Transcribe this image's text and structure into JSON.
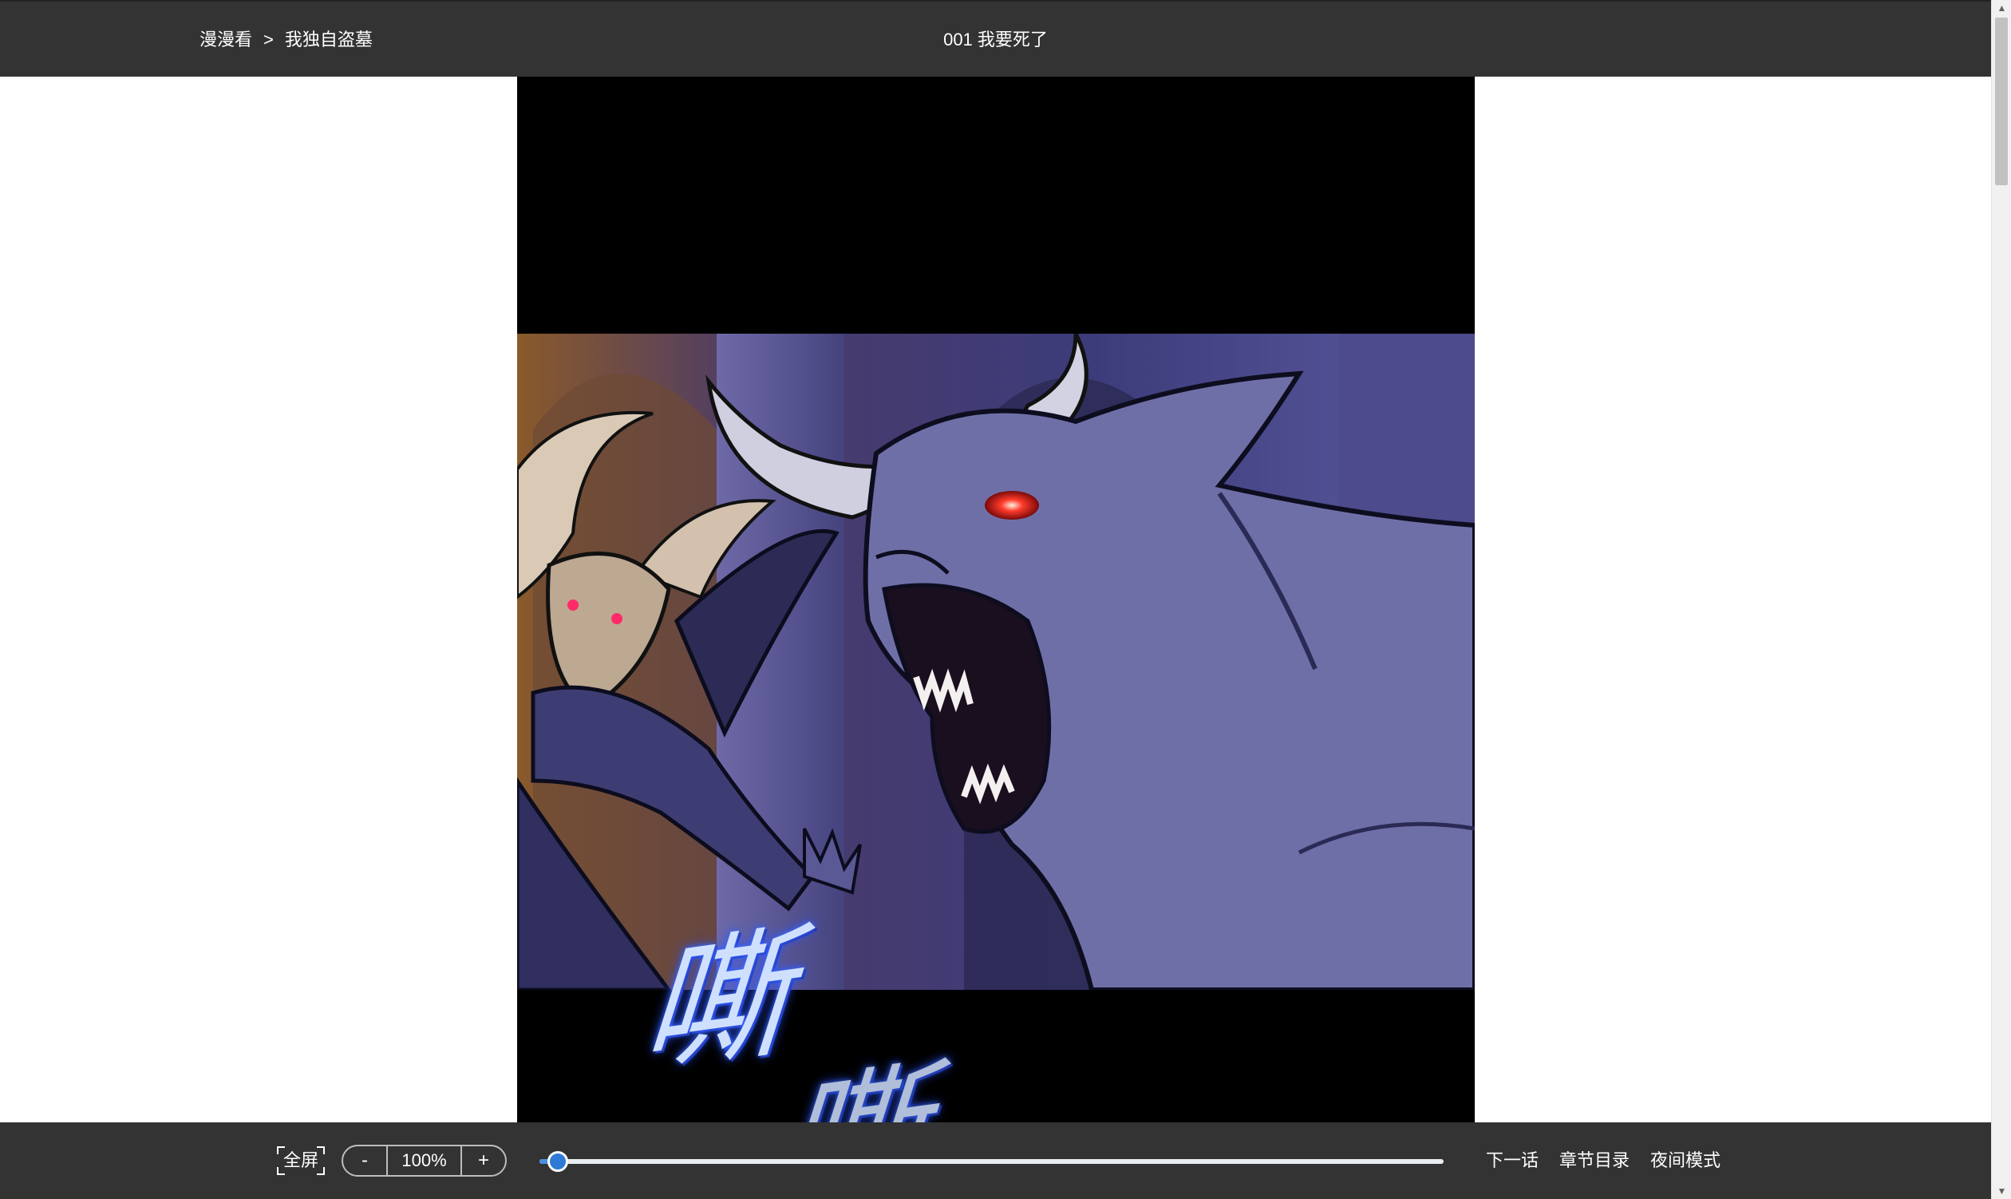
{
  "header": {
    "breadcrumb": {
      "site": "漫漫看",
      "separator": ">",
      "comic": "我独自盗墓"
    },
    "chapter_title": "001 我要死了"
  },
  "comic_page": {
    "sfx_line1": "嘶",
    "sfx_line2": "嘶"
  },
  "toolbar": {
    "fullscreen_label": "全屏",
    "zoom_out_label": "-",
    "zoom_value": "100%",
    "zoom_in_label": "+",
    "progress": 0.02,
    "next_chapter_label": "下一话",
    "chapter_list_label": "章节目录",
    "night_mode_label": "夜间模式"
  },
  "colors": {
    "bar_background": "#333333",
    "accent": "#2f7ad6"
  }
}
